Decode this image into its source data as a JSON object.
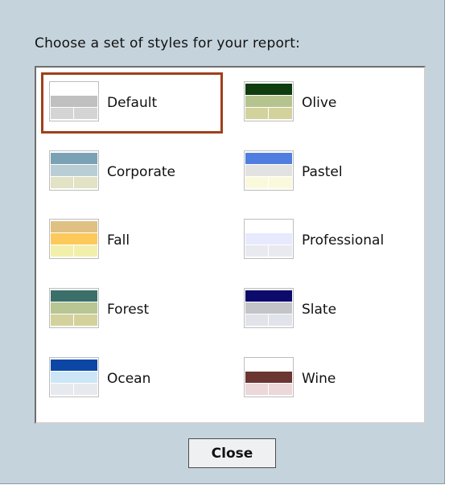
{
  "dialog": {
    "prompt": "Choose a set of styles for your report:",
    "selected": "Default",
    "close_label": "Close"
  },
  "styles": [
    {
      "label": "Default",
      "colors": {
        "head": "#ffffff",
        "sub": "#c0c0c0",
        "cell": "#d4d4d4"
      }
    },
    {
      "label": "Olive",
      "colors": {
        "head": "#0f3d0f",
        "sub": "#b5c48e",
        "cell": "#d3d29c"
      }
    },
    {
      "label": "Corporate",
      "colors": {
        "head": "#7ba1b5",
        "sub": "#b9cdd4",
        "cell": "#e2e2c4"
      }
    },
    {
      "label": "Pastel",
      "colors": {
        "head": "#4f7ee0",
        "sub": "#e2e2e2",
        "cell": "#fbf9dc"
      }
    },
    {
      "label": "Fall",
      "colors": {
        "head": "#dfc183",
        "sub": "#fdc95a",
        "cell": "#f2efaa"
      }
    },
    {
      "label": "Professional",
      "colors": {
        "head": "#ffffff",
        "sub": "#e7e9fd",
        "cell": "#e8eaef"
      }
    },
    {
      "label": "Forest",
      "colors": {
        "head": "#3a6f6a",
        "sub": "#b7c693",
        "cell": "#d3d29c"
      }
    },
    {
      "label": "Slate",
      "colors": {
        "head": "#0c0b6c",
        "sub": "#c2c4c7",
        "cell": "#e1e3ea"
      }
    },
    {
      "label": "Ocean",
      "colors": {
        "head": "#0c47a5",
        "sub": "#cde6f7",
        "cell": "#e6e9ed"
      }
    },
    {
      "label": "Wine",
      "colors": {
        "head": "#ffffff",
        "sub": "#6b3531",
        "cell": "#ecd7d9"
      }
    }
  ]
}
